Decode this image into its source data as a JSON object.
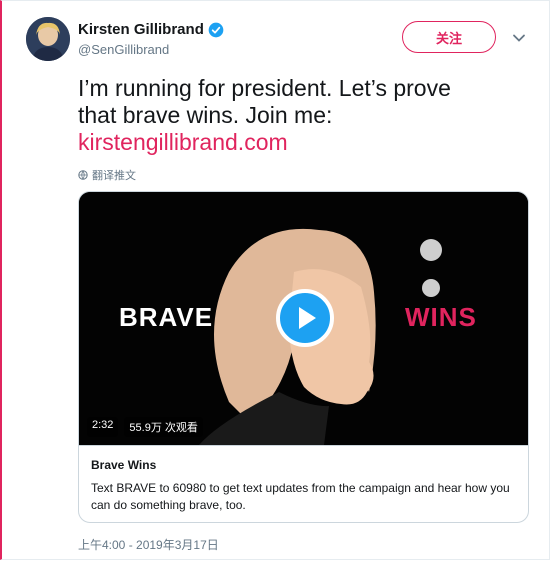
{
  "user": {
    "name": "Kirsten Gillibrand",
    "handle": "@SenGillibrand",
    "verified_icon": "verified-badge-icon",
    "avatar_icon": "avatar-photo"
  },
  "follow": {
    "label": "关注"
  },
  "tweet": {
    "line1": "I’m running for president. Let’s prove",
    "line2": "that brave wins. Join me:",
    "link": "kirstengillibrand.com"
  },
  "translate": {
    "label": "翻译推文",
    "icon": "globe-icon"
  },
  "card": {
    "video": {
      "brave_text": "BRAVE",
      "wins_text": "WINS",
      "duration": "2:32",
      "views": "55.9万 次观看",
      "play_icon": "play-icon"
    },
    "title": "Brave Wins",
    "description": "Text BRAVE to 60980 to get text updates from the campaign and hear how you can do something brave, too."
  },
  "timestamp": "上午4:00 - 2019年3月17日",
  "colors": {
    "accent": "#e0245e",
    "verified": "#1da1f2",
    "text": "#14171a",
    "muted": "#657786"
  }
}
